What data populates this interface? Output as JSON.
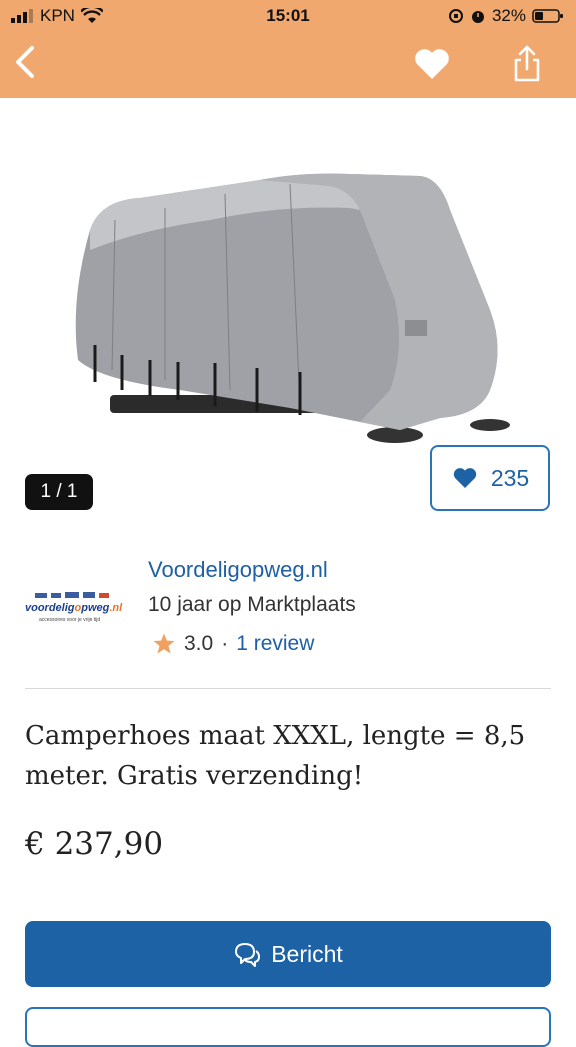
{
  "status_bar": {
    "carrier": "KPN",
    "time": "15:01",
    "battery": "32%"
  },
  "nav": {
    "back_icon": "chevron-left-icon",
    "favorite_icon": "heart-icon",
    "share_icon": "share-icon"
  },
  "gallery": {
    "counter": "1 / 1",
    "favorites_count": "235"
  },
  "seller": {
    "name": "Voordeligopweg.nl",
    "tenure": "10 jaar op Marktplaats",
    "rating": "3.0",
    "separator": "·",
    "reviews": "1 review",
    "logo_text": "voordeligopweg.nl",
    "logo_tagline": "accessoires voor je vrije tijd"
  },
  "listing": {
    "title": "Camperhoes maat XXXL, lengte = 8,5 meter. Gratis verzending!",
    "price": "€ 237,90"
  },
  "actions": {
    "message_label": "Bericht"
  },
  "colors": {
    "header_orange": "#f0a86e",
    "primary_blue": "#1e62a6",
    "star_orange": "#f0a060"
  }
}
